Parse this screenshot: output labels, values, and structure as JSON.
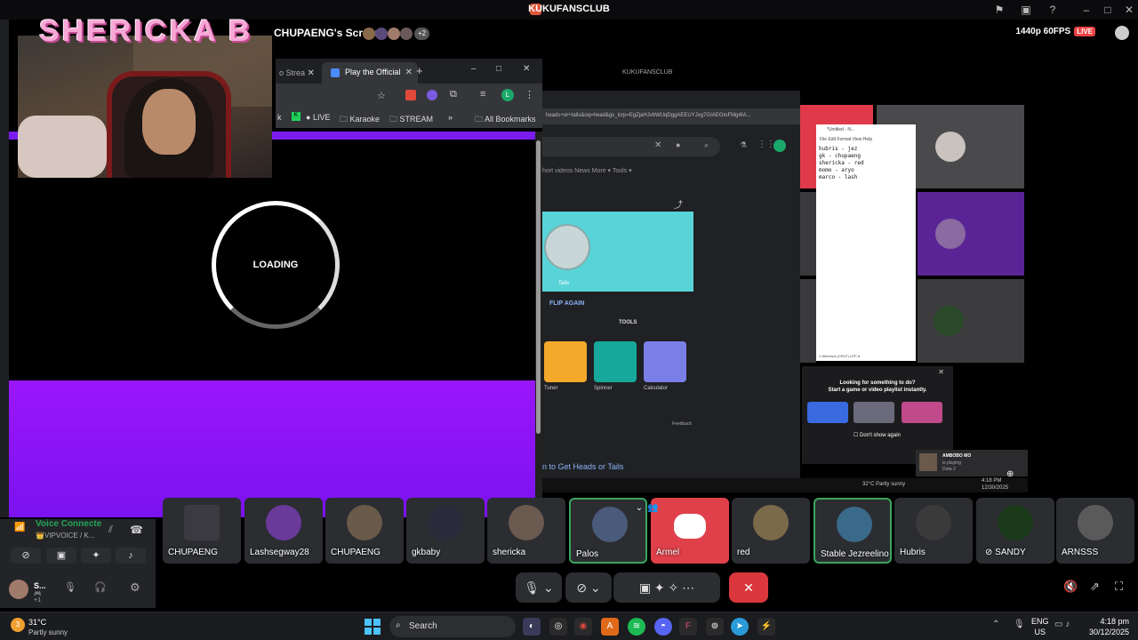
{
  "window": {
    "title": "KUKUFANSCLUB"
  },
  "stream": {
    "screen_title": "CHUPAENG's Screen",
    "extra_viewers": "+2",
    "quality": "1440p 60FPS",
    "live_badge": "LIVE"
  },
  "webcam": {
    "overlay_name": "SHERICKA B"
  },
  "browser": {
    "prev_tab_label": "o Strea",
    "active_tab_label": "Play the Official",
    "bookmarks": [
      "k",
      "LIVE",
      "Karaoke",
      "STREAM",
      "All Bookmarks"
    ],
    "loading_text": "LOADING"
  },
  "shared_screen": {
    "window_title": "KUKUFANSCLUB",
    "google": {
      "url_fragment": "heads+or+tails&oq=head&gs_lcrp=EgZjaHJvbWUqDggAEEUYJxg7GIAEGIoFMg4IA...",
      "filters": "hort videos    News    More ▾    Tools ▾",
      "coin_caption": "Tails",
      "flip_again": "FLIP AGAIN",
      "tools_label": "TOOLS",
      "tools": [
        {
          "label": "Tuner",
          "color": "#f4a92b"
        },
        {
          "label": "Spinner",
          "color": "#16a89a"
        },
        {
          "label": "Calculator",
          "color": "#7a7fe8"
        }
      ],
      "feedback": "Feedback",
      "cta": "n to Get Heads or Tails"
    },
    "notepad": {
      "title": "*Untitled - N...",
      "menu": "File   Edit   Format   View   Help",
      "text": "hubris - jez\ngk - chupaeng\nshericka - red\nmomo - aryo\nmarco - lash",
      "status": "1 Windows (CRLF)      UTF-8"
    },
    "suggest": {
      "line1": "Looking for something to do?",
      "line2": "Start a game or video playlist instantly.",
      "dont_show": "Don't show again"
    },
    "amb": {
      "name": "AMBOBO MO",
      "status": "is playing",
      "game": "Dota 2"
    },
    "mini_taskbar": {
      "weather": "32°C  Partly sunny",
      "time": "4:18 PM",
      "date": "12/30/2025"
    }
  },
  "voice": {
    "status": "Voice Connecte",
    "channel": "👑VIPVOICE / K...",
    "user_name": "S...",
    "user_sub": "🎮 +1"
  },
  "participants": [
    {
      "name": "CHUPAENG",
      "color": "#3a3a40"
    },
    {
      "name": "Lashsegway28",
      "color": "#6a3a9a"
    },
    {
      "name": "CHUPAENG",
      "color": "#6a5a4a"
    },
    {
      "name": "gkbaby",
      "color": "#2a2a3a"
    },
    {
      "name": "shericka",
      "color": "#6b5a50"
    },
    {
      "name": "Palos",
      "color": "#4a5a7a"
    },
    {
      "name": "Armel",
      "color": "#e0404a"
    },
    {
      "name": "red",
      "color": "#7a6a4a"
    },
    {
      "name": "Stable Jezreelino",
      "color": "#3a6a8a"
    },
    {
      "name": "Hubris",
      "color": "#3a3a3a"
    },
    {
      "name": "SANDY",
      "color": "#1a3a1a"
    },
    {
      "name": "ARNSSS",
      "color": "#5a5a5a"
    }
  ],
  "taskbar": {
    "weather_temp": "31°C",
    "weather_cond": "Partly sunny",
    "search": "Search",
    "lang": "ENG",
    "region": "US",
    "time": "4:18 pm",
    "date": "30/12/2025",
    "notifications": "3"
  }
}
